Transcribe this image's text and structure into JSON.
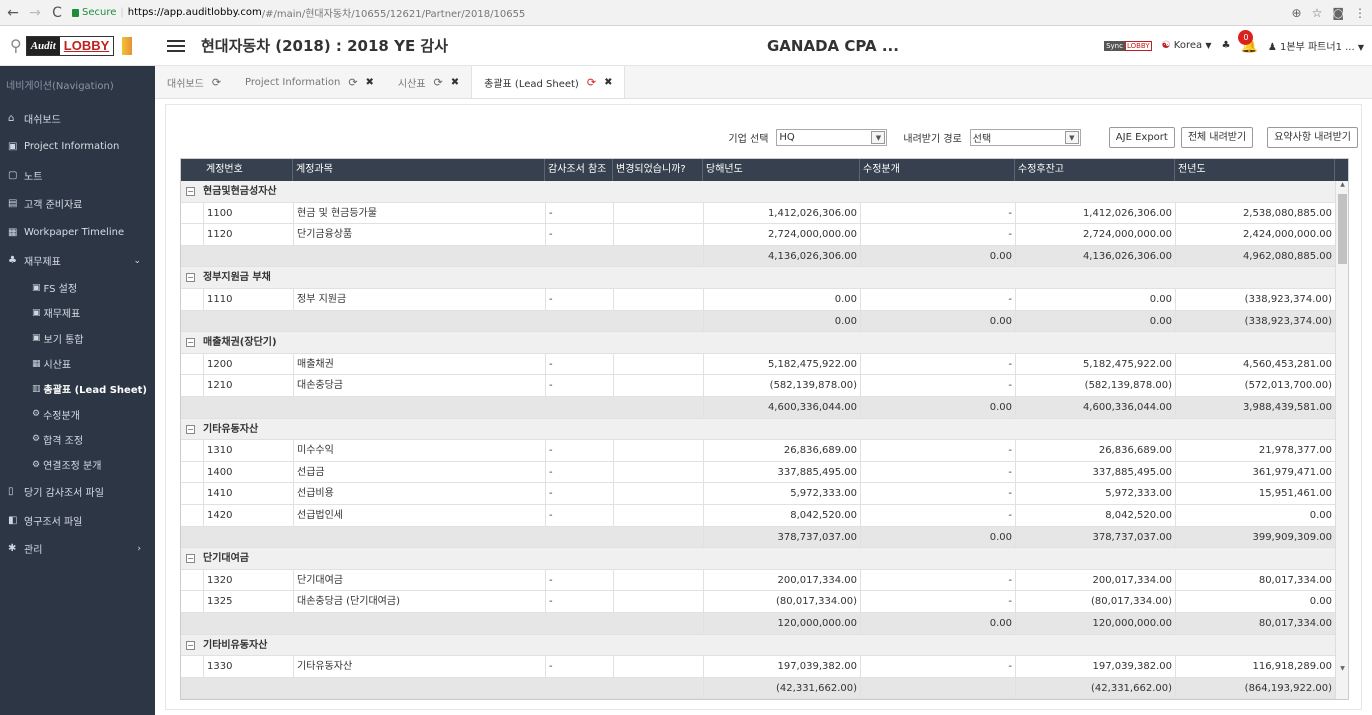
{
  "browser": {
    "back": "←",
    "forward": "→",
    "reload": "C",
    "secure": "Secure",
    "url_host": "https://app.auditlobby.com",
    "url_path": "/#/main/현대자동차/10655/12621/Partner/2018/10655",
    "icons": [
      "zoom-icon",
      "star-icon",
      "camera-icon",
      "menu-icon"
    ]
  },
  "header": {
    "logo_audit": "Audit",
    "logo_lobby": "LOBBY",
    "title": "현대자동차 (2018) : 2018 YE 감사",
    "firm": "GANADA CPA ...",
    "sync": "Sync",
    "sync_lobby": "LOBBY",
    "language": "Korea",
    "notification_count": "0",
    "user": "1본부 파트너1 ..."
  },
  "sidebar": {
    "title": "네비게이션(Navigation)",
    "items": [
      {
        "label": "대쉬보드",
        "icon": "home-icon",
        "glyph": "⌂"
      },
      {
        "label": "Project Information",
        "icon": "info-icon",
        "glyph": "▣"
      },
      {
        "label": "노트",
        "icon": "note-icon",
        "glyph": "▢"
      },
      {
        "label": "고객 준비자료",
        "icon": "folder-icon",
        "glyph": "▤"
      },
      {
        "label": "Workpaper Timeline",
        "icon": "calendar-icon",
        "glyph": "▦"
      },
      {
        "label": "재무제표",
        "icon": "tree-icon",
        "glyph": "♣"
      }
    ],
    "subitems": [
      {
        "label": "FS 설정",
        "glyph": "▣"
      },
      {
        "label": "재무제표",
        "glyph": "▣"
      },
      {
        "label": "보기 통합",
        "glyph": "▣"
      },
      {
        "label": "시산표",
        "glyph": "▦"
      },
      {
        "label": "총괄표 (Lead Sheet)",
        "glyph": "▥"
      },
      {
        "label": "수정분개",
        "glyph": "⚙"
      },
      {
        "label": "합격 조정",
        "glyph": "⚙"
      },
      {
        "label": "연결조정 분개",
        "glyph": "⚙"
      }
    ],
    "bottom_items": [
      {
        "label": "당기 감사조서 파일",
        "icon": "file-icon",
        "glyph": "▯"
      },
      {
        "label": "영구조서 파일",
        "icon": "files-icon",
        "glyph": "◧"
      },
      {
        "label": "관리",
        "icon": "gear-icon",
        "glyph": "✱"
      }
    ]
  },
  "tabs": [
    {
      "label": "대쉬보드"
    },
    {
      "label": "Project Information"
    },
    {
      "label": "시산표"
    },
    {
      "label": "총괄표 (Lead Sheet)"
    }
  ],
  "toolbar": {
    "company_label": "기업 선택",
    "company_value": "HQ",
    "path_label": "내려받기 경로",
    "path_value": "선택",
    "aje_export": "AJE Export",
    "download_all": "전체 내려받기",
    "download_summary": "요약사항 내려받기"
  },
  "grid": {
    "headers": [
      "계정번호",
      "계정과목",
      "감사조서 참조",
      "변경되었습니까?",
      "당해년도",
      "수정분개",
      "수정후잔고",
      "전년도"
    ],
    "groups": [
      {
        "title": "현금및현금성자산",
        "rows": [
          [
            "1100",
            "현금 및 현금등가물",
            "-",
            "",
            "1,412,026,306.00",
            "-",
            "1,412,026,306.00",
            "2,538,080,885.00"
          ],
          [
            "1120",
            "단기금융상품",
            "-",
            "",
            "2,724,000,000.00",
            "-",
            "2,724,000,000.00",
            "2,424,000,000.00"
          ]
        ],
        "subtotal": [
          "4,136,026,306.00",
          "0.00",
          "4,136,026,306.00",
          "4,962,080,885.00"
        ]
      },
      {
        "title": "정부지원금 부채",
        "rows": [
          [
            "1110",
            "정부 지원금",
            "-",
            "",
            "0.00",
            "-",
            "0.00",
            "(338,923,374.00)"
          ]
        ],
        "subtotal": [
          "0.00",
          "0.00",
          "0.00",
          "(338,923,374.00)"
        ]
      },
      {
        "title": "매출채권(장단기)",
        "rows": [
          [
            "1200",
            "매출채권",
            "-",
            "",
            "5,182,475,922.00",
            "-",
            "5,182,475,922.00",
            "4,560,453,281.00"
          ],
          [
            "1210",
            "대손충당금",
            "-",
            "",
            "(582,139,878.00)",
            "-",
            "(582,139,878.00)",
            "(572,013,700.00)"
          ]
        ],
        "subtotal": [
          "4,600,336,044.00",
          "0.00",
          "4,600,336,044.00",
          "3,988,439,581.00"
        ]
      },
      {
        "title": "기타유동자산",
        "rows": [
          [
            "1310",
            "미수수익",
            "-",
            "",
            "26,836,689.00",
            "-",
            "26,836,689.00",
            "21,978,377.00"
          ],
          [
            "1400",
            "선급금",
            "-",
            "",
            "337,885,495.00",
            "-",
            "337,885,495.00",
            "361,979,471.00"
          ],
          [
            "1410",
            "선급비용",
            "-",
            "",
            "5,972,333.00",
            "-",
            "5,972,333.00",
            "15,951,461.00"
          ],
          [
            "1420",
            "선급법인세",
            "-",
            "",
            "8,042,520.00",
            "-",
            "8,042,520.00",
            "0.00"
          ]
        ],
        "subtotal": [
          "378,737,037.00",
          "0.00",
          "378,737,037.00",
          "399,909,309.00"
        ]
      },
      {
        "title": "단기대여금",
        "rows": [
          [
            "1320",
            "단기대여금",
            "-",
            "",
            "200,017,334.00",
            "-",
            "200,017,334.00",
            "80,017,334.00"
          ],
          [
            "1325",
            "대손충당금 (단기대여금)",
            "-",
            "",
            "(80,017,334.00)",
            "-",
            "(80,017,334.00)",
            "0.00"
          ]
        ],
        "subtotal": [
          "120,000,000.00",
          "0.00",
          "120,000,000.00",
          "80,017,334.00"
        ]
      },
      {
        "title": "기타비유동자산",
        "rows": [
          [
            "1330",
            "기타유동자산",
            "-",
            "",
            "197,039,382.00",
            "-",
            "197,039,382.00",
            "116,918,289.00"
          ]
        ],
        "subtotal": [
          "(42,331,662.00)",
          "",
          "(42,331,662.00)",
          "(864,193,922.00)"
        ]
      }
    ]
  }
}
